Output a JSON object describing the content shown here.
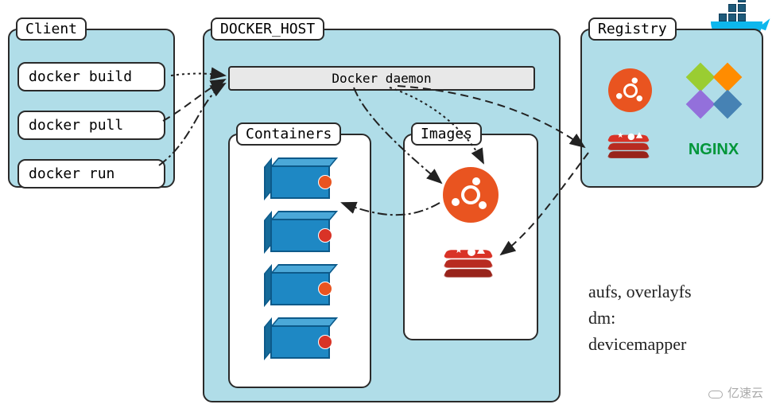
{
  "panels": {
    "client": {
      "label": "Client"
    },
    "host": {
      "label": "DOCKER_HOST"
    },
    "registry": {
      "label": "Registry"
    },
    "containers": {
      "label": "Containers"
    },
    "images": {
      "label": "Images"
    }
  },
  "client_commands": {
    "build": "docker build",
    "pull": "docker pull",
    "run": "docker run"
  },
  "daemon": {
    "label": "Docker daemon"
  },
  "registry_logos": {
    "ubuntu": "ubuntu",
    "centos": "centos",
    "redis": "redis",
    "nginx": "NGINX"
  },
  "images_list": {
    "ubuntu": "ubuntu",
    "redis": "redis"
  },
  "containers_list": {
    "c1": "ubuntu",
    "c2": "redis",
    "c3": "ubuntu",
    "c4": "redis"
  },
  "notes": {
    "line1": "aufs, overlayfs",
    "line2": "dm:",
    "line3": "devicemapper"
  },
  "watermark": "亿速云",
  "colors": {
    "panel_bg": "#b0dde8",
    "ubuntu": "#e95420",
    "redis": "#d93327",
    "nginx": "#009639",
    "docker_whale": "#0db7ed",
    "container_blue": "#1e88c4"
  }
}
